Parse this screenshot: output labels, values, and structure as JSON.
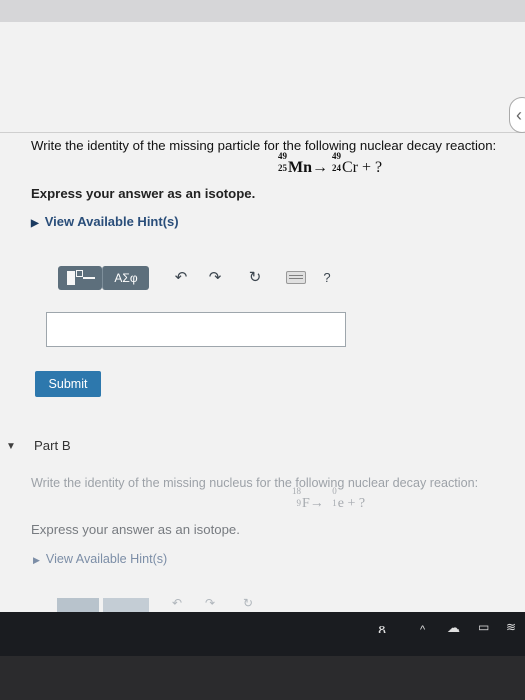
{
  "part_a": {
    "question": "Write the identity of the missing particle for the following nuclear decay reaction:",
    "equation": {
      "reactant": {
        "mass": "49",
        "atomic": "25",
        "symbol": "Mn"
      },
      "arrow": "→",
      "product": {
        "mass": "49",
        "atomic": "24",
        "symbol": "Cr"
      },
      "plus": "+",
      "unknown": "?"
    },
    "instruction": "Express your answer as an isotope.",
    "hint_label": "View Available Hint(s)",
    "toolbar": {
      "greek_label": "ΑΣφ",
      "help_label": "?"
    },
    "answer_value": "",
    "submit_label": "Submit"
  },
  "part_b": {
    "title": "Part B",
    "question": "Write the identity of the missing nucleus for the following nuclear decay reaction:",
    "equation": {
      "reactant": {
        "mass": "18",
        "atomic": "9",
        "symbol": "F"
      },
      "arrow": "→",
      "product": {
        "mass": "0",
        "atomic": "1",
        "symbol": "e"
      },
      "plus": "+",
      "unknown": "?"
    },
    "instruction": "Express your answer as an isotope.",
    "hint_label": "View Available Hint(s)"
  },
  "icons": [
    "template-icon",
    "greek-symbols-icon",
    "undo-icon",
    "redo-icon",
    "reset-icon",
    "keyboard-icon",
    "help-icon",
    "shield-icon",
    "people-icon",
    "chevron-up-icon",
    "cloud-icon",
    "battery-icon",
    "wifi-icon"
  ],
  "colors": {
    "submit": "#2d78ad",
    "toolbar": "#5d6f7c",
    "hint": "#2a4e7a"
  }
}
